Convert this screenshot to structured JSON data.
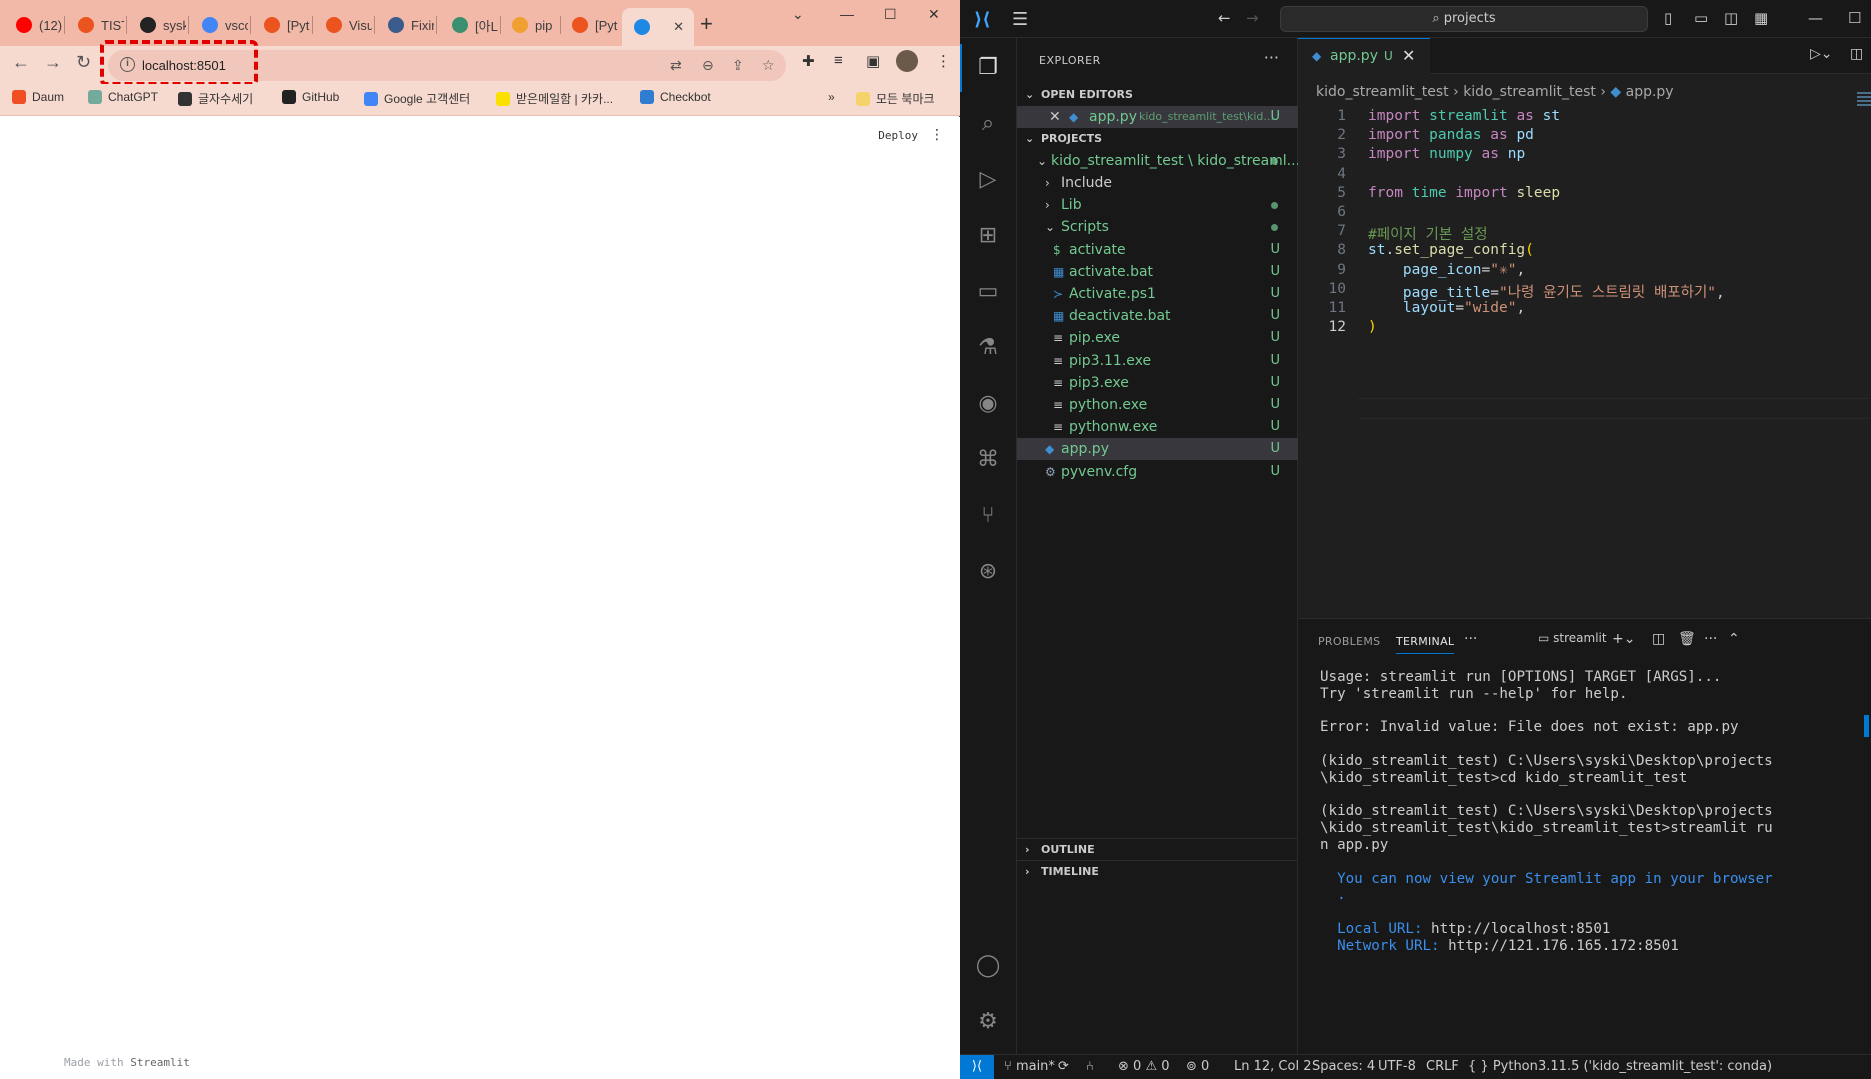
{
  "browser": {
    "tabs": [
      {
        "label": "(12)",
        "icon": "youtube-icon",
        "color": "#ff0000"
      },
      {
        "label": "TIST",
        "icon": "tistory-icon",
        "color": "#eb531f"
      },
      {
        "label": "sysk",
        "icon": "github-icon",
        "color": "#222222"
      },
      {
        "label": "vscc",
        "icon": "google-icon",
        "color": "#4285f4"
      },
      {
        "label": "[Pyt",
        "icon": "tistory-icon",
        "color": "#eb531f"
      },
      {
        "label": "Visu",
        "icon": "tistory-icon",
        "color": "#eb531f"
      },
      {
        "label": "Fixin",
        "icon": "page-icon",
        "color": "#3b5b8c"
      },
      {
        "label": "[아L",
        "icon": "bird-icon",
        "color": "#3a8f6e"
      },
      {
        "label": "pip",
        "icon": "pip-icon",
        "color": "#f0a030"
      },
      {
        "label": "[Pyt",
        "icon": "tistory-icon",
        "color": "#eb531f"
      },
      {
        "label": "",
        "icon": "streamlit-snowflake-icon",
        "color": "#1e88e5",
        "active": true
      }
    ],
    "url": "localhost:8501",
    "bookmarks": [
      {
        "label": "Daum",
        "icon": "daum-icon",
        "color": "#f04e23"
      },
      {
        "label": "ChatGPT",
        "icon": "chatgpt-icon",
        "color": "#74aa9c"
      },
      {
        "label": "글자수세기",
        "icon": "counter-icon",
        "color": "#333333"
      },
      {
        "label": "GitHub",
        "icon": "github-icon",
        "color": "#222222"
      },
      {
        "label": "Google 고객센터",
        "icon": "google-icon",
        "color": "#4285f4"
      },
      {
        "label": "받은메일함 | 카카...",
        "icon": "kakao-mail-icon",
        "color": "#fae100"
      },
      {
        "label": "Checkbot",
        "icon": "checkbot-icon",
        "color": "#2f7dd1"
      }
    ],
    "bookmarks_overflow": "»",
    "all_bookmarks": "모든 북마크",
    "page": {
      "deploy": "Deploy",
      "made_with": "Made with",
      "streamlit": "Streamlit"
    }
  },
  "vscode": {
    "command_center": "projects",
    "explorer_title": "EXPLORER",
    "open_editors_title": "OPEN EDITORS",
    "open_editor": {
      "name": "app.py",
      "path": "kido_streamlit_test\\kid...",
      "badge": "U"
    },
    "projects_title": "PROJECTS",
    "project_root": "kido_streamlit_test \\ kido_streaml...",
    "tree": [
      {
        "label": "Include",
        "kind": "folder",
        "depth": 1,
        "status": "",
        "expanded": false
      },
      {
        "label": "Lib",
        "kind": "folder",
        "depth": 1,
        "status": "dot",
        "expanded": false
      },
      {
        "label": "Scripts",
        "kind": "folder",
        "depth": 1,
        "status": "dot",
        "expanded": true
      },
      {
        "label": "activate",
        "kind": "shell",
        "depth": 2,
        "status": "U"
      },
      {
        "label": "activate.bat",
        "kind": "bat",
        "depth": 2,
        "status": "U"
      },
      {
        "label": "Activate.ps1",
        "kind": "ps",
        "depth": 2,
        "status": "U"
      },
      {
        "label": "deactivate.bat",
        "kind": "bat",
        "depth": 2,
        "status": "U"
      },
      {
        "label": "pip.exe",
        "kind": "file",
        "depth": 2,
        "status": "U"
      },
      {
        "label": "pip3.11.exe",
        "kind": "file",
        "depth": 2,
        "status": "U"
      },
      {
        "label": "pip3.exe",
        "kind": "file",
        "depth": 2,
        "status": "U"
      },
      {
        "label": "python.exe",
        "kind": "file",
        "depth": 2,
        "status": "U"
      },
      {
        "label": "pythonw.exe",
        "kind": "file",
        "depth": 2,
        "status": "U"
      },
      {
        "label": "app.py",
        "kind": "python",
        "depth": 1,
        "status": "U",
        "selected": true
      },
      {
        "label": "pyvenv.cfg",
        "kind": "gear",
        "depth": 1,
        "status": "U"
      }
    ],
    "outline_title": "OUTLINE",
    "timeline_title": "TIMELINE",
    "editor_tab": {
      "name": "app.py",
      "badge": "U"
    },
    "breadcrumb": [
      "kido_streamlit_test",
      "kido_streamlit_test",
      "app.py"
    ],
    "code_lines": [
      "import streamlit as st",
      "import pandas as pd",
      "import numpy as np",
      "",
      "from time import sleep",
      "",
      "#페이지 기본 설정",
      "st.set_page_config(",
      "    page_icon=\"✳\",",
      "    page_title=\"나령 윤기도 스트림릿 배포하기\",",
      "    layout=\"wide\",",
      ")"
    ],
    "current_line": 12,
    "panel_tabs": [
      "PROBLEMS",
      "TERMINAL"
    ],
    "terminal_name": "streamlit",
    "terminal_lines": [
      "Usage: streamlit run [OPTIONS] TARGET [ARGS]...",
      "Try 'streamlit run --help' for help.",
      "",
      "Error: Invalid value: File does not exist: app.py",
      "",
      "(kido_streamlit_test) C:\\Users\\syski\\Desktop\\projects",
      "\\kido_streamlit_test>cd kido_streamlit_test",
      "",
      "(kido_streamlit_test) C:\\Users\\syski\\Desktop\\projects",
      "\\kido_streamlit_test\\kido_streamlit_test>streamlit ru",
      "n app.py",
      "",
      "  You can now view your Streamlit app in your browser",
      "  .",
      "",
      "  Local URL: http://localhost:8501",
      "  Network URL: http://121.176.165.172:8501"
    ],
    "status": {
      "branch": "main*",
      "errors": "0",
      "warnings": "0",
      "ports": "0",
      "cursor": "Ln 12, Col 2",
      "spaces": "Spaces: 4",
      "encoding": "UTF-8",
      "eol": "CRLF",
      "language": "Python",
      "interpreter": "3.11.5 ('kido_streamlit_test': conda)"
    }
  }
}
